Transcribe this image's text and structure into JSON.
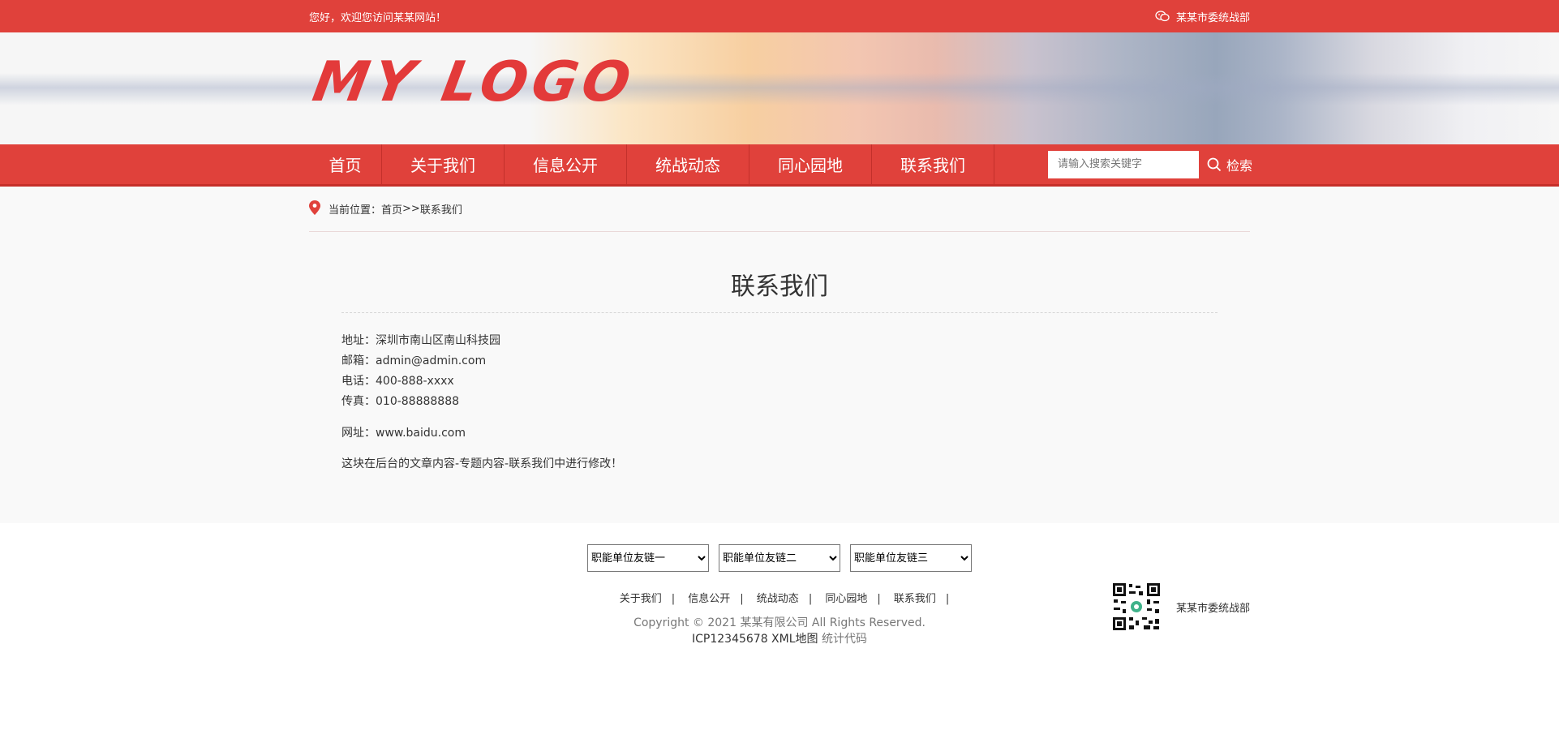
{
  "topbar": {
    "welcome": "您好，欢迎您访问某某网站！",
    "org_name": "某某市委统战部",
    "wechat_icon": "wechat-icon"
  },
  "banner": {
    "logo_text": "MY LOGO"
  },
  "nav": {
    "items": [
      {
        "label": "首页"
      },
      {
        "label": "关于我们"
      },
      {
        "label": "信息公开"
      },
      {
        "label": "统战动态"
      },
      {
        "label": "同心园地"
      },
      {
        "label": "联系我们"
      }
    ],
    "search_placeholder": "请输入搜索关键字",
    "search_label": "检索"
  },
  "breadcrumb": {
    "prefix": "当前位置：",
    "home": "首页",
    "sep": ">>",
    "current": "联系我们"
  },
  "content": {
    "title": "联系我们",
    "address": "地址：深圳市南山区南山科技园",
    "email": "邮箱：admin@admin.com",
    "phone": "电话：400-888-xxxx",
    "fax": "传真：010-88888888",
    "website": "网址：www.baidu.com",
    "note": "这块在后台的文章内容-专题内容-联系我们中进行修改！"
  },
  "footer": {
    "selects": [
      {
        "selected": "职能单位友链一"
      },
      {
        "selected": "职能单位友链二"
      },
      {
        "selected": "职能单位友链三"
      }
    ],
    "links": [
      {
        "label": "关于我们"
      },
      {
        "label": "信息公开"
      },
      {
        "label": "统战动态"
      },
      {
        "label": "同心园地"
      },
      {
        "label": "联系我们"
      }
    ],
    "link_sep": "|",
    "copyright": "Copyright © 2021 某某有限公司 All Rights Reserved.",
    "icp": "ICP12345678 XML地图",
    "stats": "统计代码",
    "qr_label": "某某市委统战部"
  },
  "colors": {
    "brand_red": "#e0413b",
    "nav_border": "#c62f2a"
  }
}
